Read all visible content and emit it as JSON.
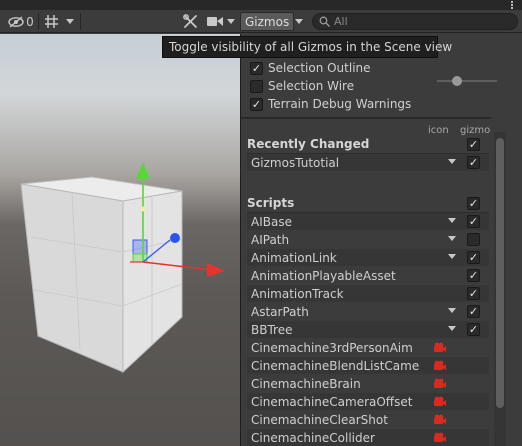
{
  "toolbar": {
    "visibility_count": "0",
    "gizmos_label": "Gizmos",
    "search_placeholder": "All"
  },
  "tooltip": "Toggle visibility of all Gizmos in the Scene view",
  "options": [
    {
      "label": "Selection Outline",
      "checked": true
    },
    {
      "label": "Selection Wire",
      "checked": false
    },
    {
      "label": "Terrain Debug Warnings",
      "checked": true
    }
  ],
  "columns": {
    "icon": "icon",
    "gizmo": "gizmo"
  },
  "recently_changed": {
    "title": "Recently Changed",
    "items": [
      {
        "label": "GizmosTutotial",
        "dropdown": true,
        "checked": true
      }
    ]
  },
  "scripts": {
    "title": "Scripts",
    "items": [
      {
        "label": "AIBase",
        "dropdown": true,
        "checked": true,
        "icon": null
      },
      {
        "label": "AIPath",
        "dropdown": true,
        "checked": false,
        "icon": null
      },
      {
        "label": "AnimationLink",
        "dropdown": true,
        "checked": true,
        "icon": null
      },
      {
        "label": "AnimationPlayableAsset",
        "dropdown": false,
        "checked": true,
        "icon": null
      },
      {
        "label": "AnimationTrack",
        "dropdown": false,
        "checked": true,
        "icon": null
      },
      {
        "label": "AstarPath",
        "dropdown": true,
        "checked": true,
        "icon": null
      },
      {
        "label": "BBTree",
        "dropdown": true,
        "checked": true,
        "icon": null
      },
      {
        "label": "Cinemachine3rdPersonAim",
        "dropdown": false,
        "checked": null,
        "icon": "cinemachine-camera-icon"
      },
      {
        "label": "CinemachineBlendListCame",
        "dropdown": false,
        "checked": null,
        "icon": "cinemachine-camera-icon"
      },
      {
        "label": "CinemachineBrain",
        "dropdown": false,
        "checked": null,
        "icon": "cinemachine-camera-icon"
      },
      {
        "label": "CinemachineCameraOffset",
        "dropdown": false,
        "checked": null,
        "icon": "cinemachine-camera-icon"
      },
      {
        "label": "CinemachineClearShot",
        "dropdown": false,
        "checked": null,
        "icon": "cinemachine-camera-icon"
      },
      {
        "label": "CinemachineCollider",
        "dropdown": false,
        "checked": null,
        "icon": "cinemachine-camera-icon"
      }
    ]
  },
  "icons": {
    "visibility": "eye-slash-icon",
    "grid": "grid-icon",
    "tools": "tools-icon",
    "camera": "video-camera-icon",
    "search": "search-icon"
  },
  "colors": {
    "x_axis": "#e8322c",
    "y_axis": "#58d63a",
    "z_axis": "#3b5cff",
    "handle_sphere": "#2a55f0"
  }
}
